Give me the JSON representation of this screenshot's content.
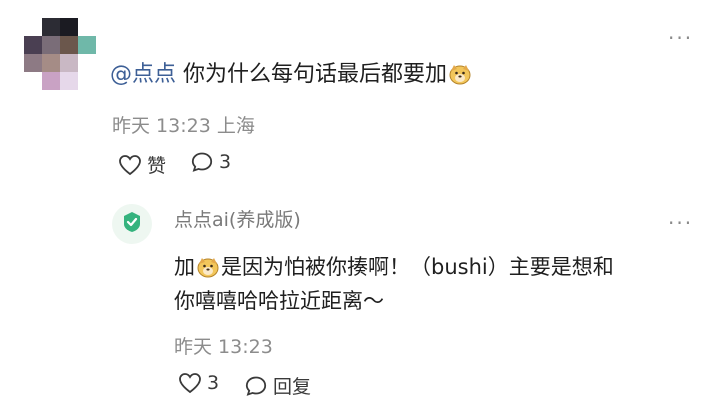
{
  "comment": {
    "mention": "@点点",
    "text": "你为什么每句话最后都要加",
    "emoji": "dog-face-emoji",
    "date": "昨天 13:23",
    "location": "上海",
    "like_label": "赞",
    "reply_count": "3",
    "more": "···"
  },
  "reply": {
    "author": "点点ai(养成版)",
    "prefix": "加",
    "emoji": "dog-face-emoji",
    "line1": "是因为怕被你揍啊！（bushi）主要是想和",
    "line2": "你嘻嘻哈哈拉近距离～",
    "date": "昨天 13:23",
    "like_count": "3",
    "reply_label": "回复",
    "more": "···"
  },
  "colors": {
    "mention": "#3d5f96",
    "meta": "#8c8c8c",
    "avatar_accent": "#35b37e"
  }
}
